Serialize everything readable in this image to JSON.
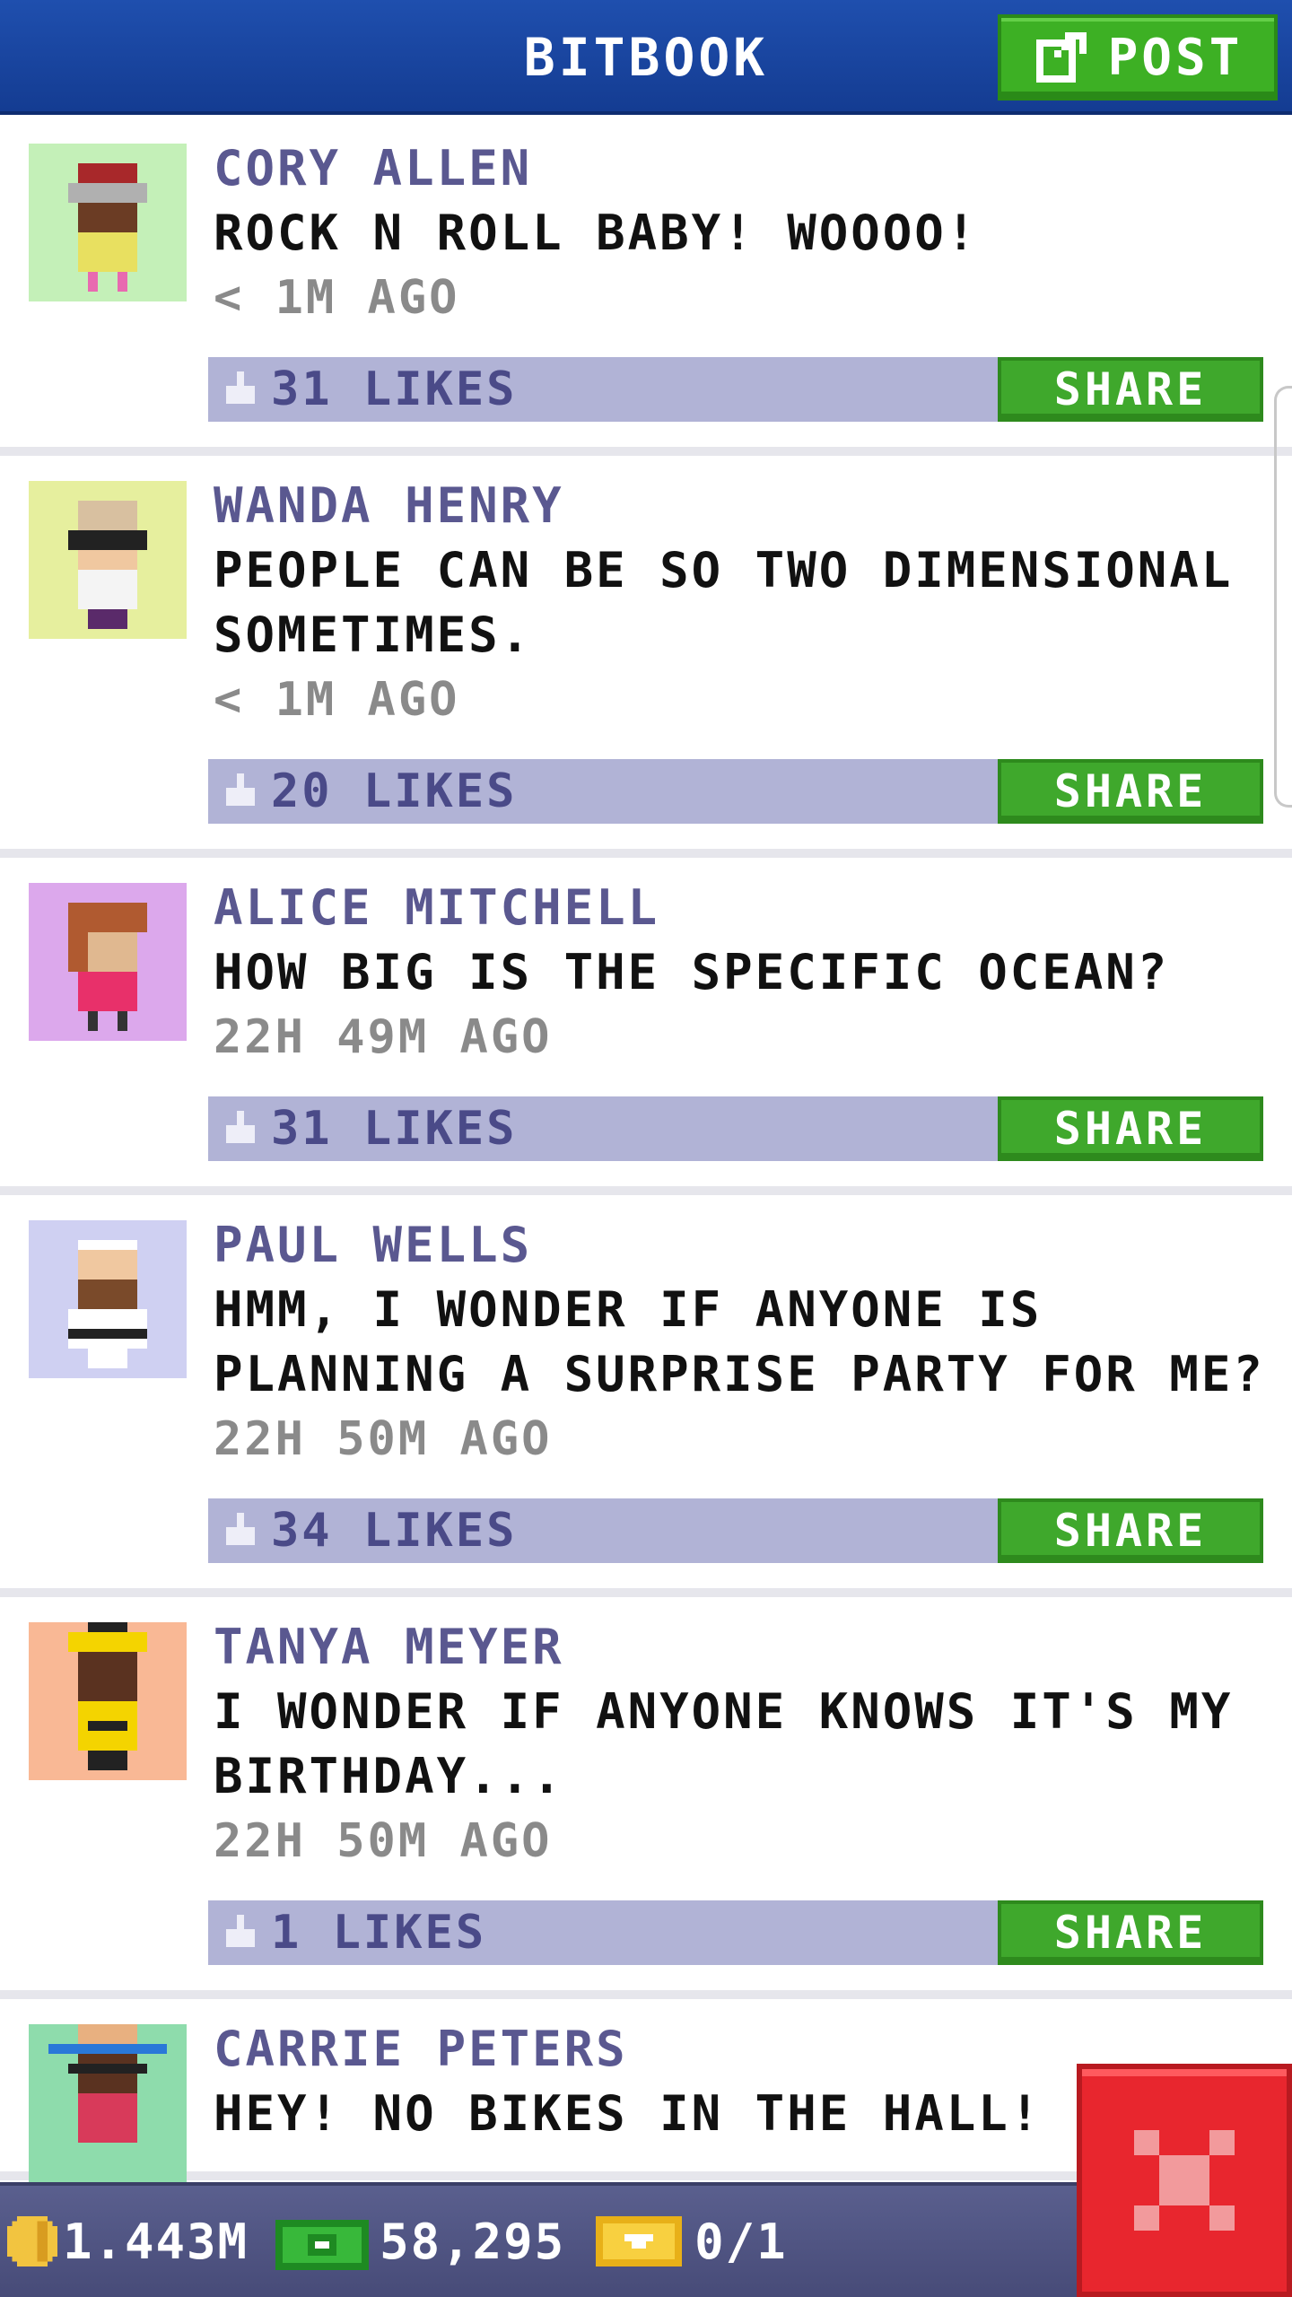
{
  "header": {
    "title": "BITBOOK",
    "post_label": "POST"
  },
  "colors": {
    "header": "#1f4fae",
    "post_button": "#3db024",
    "likes_bar": "#b1b3d6",
    "name": "#5a5890",
    "bottom_bar": "#4a4e7c",
    "close_button": "#e8262e"
  },
  "posts": [
    {
      "name": "CORY ALLEN",
      "message": "ROCK N ROLL BABY! WOOOO!",
      "time": "< 1M AGO",
      "likes": "31 LIKES",
      "share": "SHARE",
      "avatar_bg": "#c4f0b8"
    },
    {
      "name": "WANDA HENRY",
      "message": "PEOPLE CAN BE SO TWO DIMENSIONAL SOMETIMES.",
      "time": "< 1M AGO",
      "likes": "20 LIKES",
      "share": "SHARE",
      "avatar_bg": "#e6ef9e"
    },
    {
      "name": "ALICE MITCHELL",
      "message": "HOW BIG IS THE SPECIFIC OCEAN?",
      "time": "22H 49M AGO",
      "likes": "31 LIKES",
      "share": "SHARE",
      "avatar_bg": "#dca8ec"
    },
    {
      "name": "PAUL WELLS",
      "message": "HMM, I WONDER IF ANYONE IS PLANNING A SURPRISE PARTY FOR ME?",
      "time": "22H 50M AGO",
      "likes": "34 LIKES",
      "share": "SHARE",
      "avatar_bg": "#cfd0f2"
    },
    {
      "name": "TANYA MEYER",
      "message": "I WONDER IF ANYONE KNOWS IT'S MY BIRTHDAY...",
      "time": "22H 50M AGO",
      "likes": "1 LIKES",
      "share": "SHARE",
      "avatar_bg": "#f9b895"
    },
    {
      "name": "CARRIE PETERS",
      "message": "HEY! NO BIKES IN THE HALL!",
      "time": "",
      "likes": "",
      "share": "",
      "avatar_bg": "#8edcac"
    }
  ],
  "bottom_bar": {
    "coins": "1.443M",
    "bux": "58,295",
    "tickets": "0/1"
  },
  "icons": {
    "post": "edit-icon",
    "like": "thumbs-up-icon",
    "coin": "coin-icon",
    "bux": "bux-icon",
    "ticket": "ticket-icon",
    "close": "close-icon"
  }
}
